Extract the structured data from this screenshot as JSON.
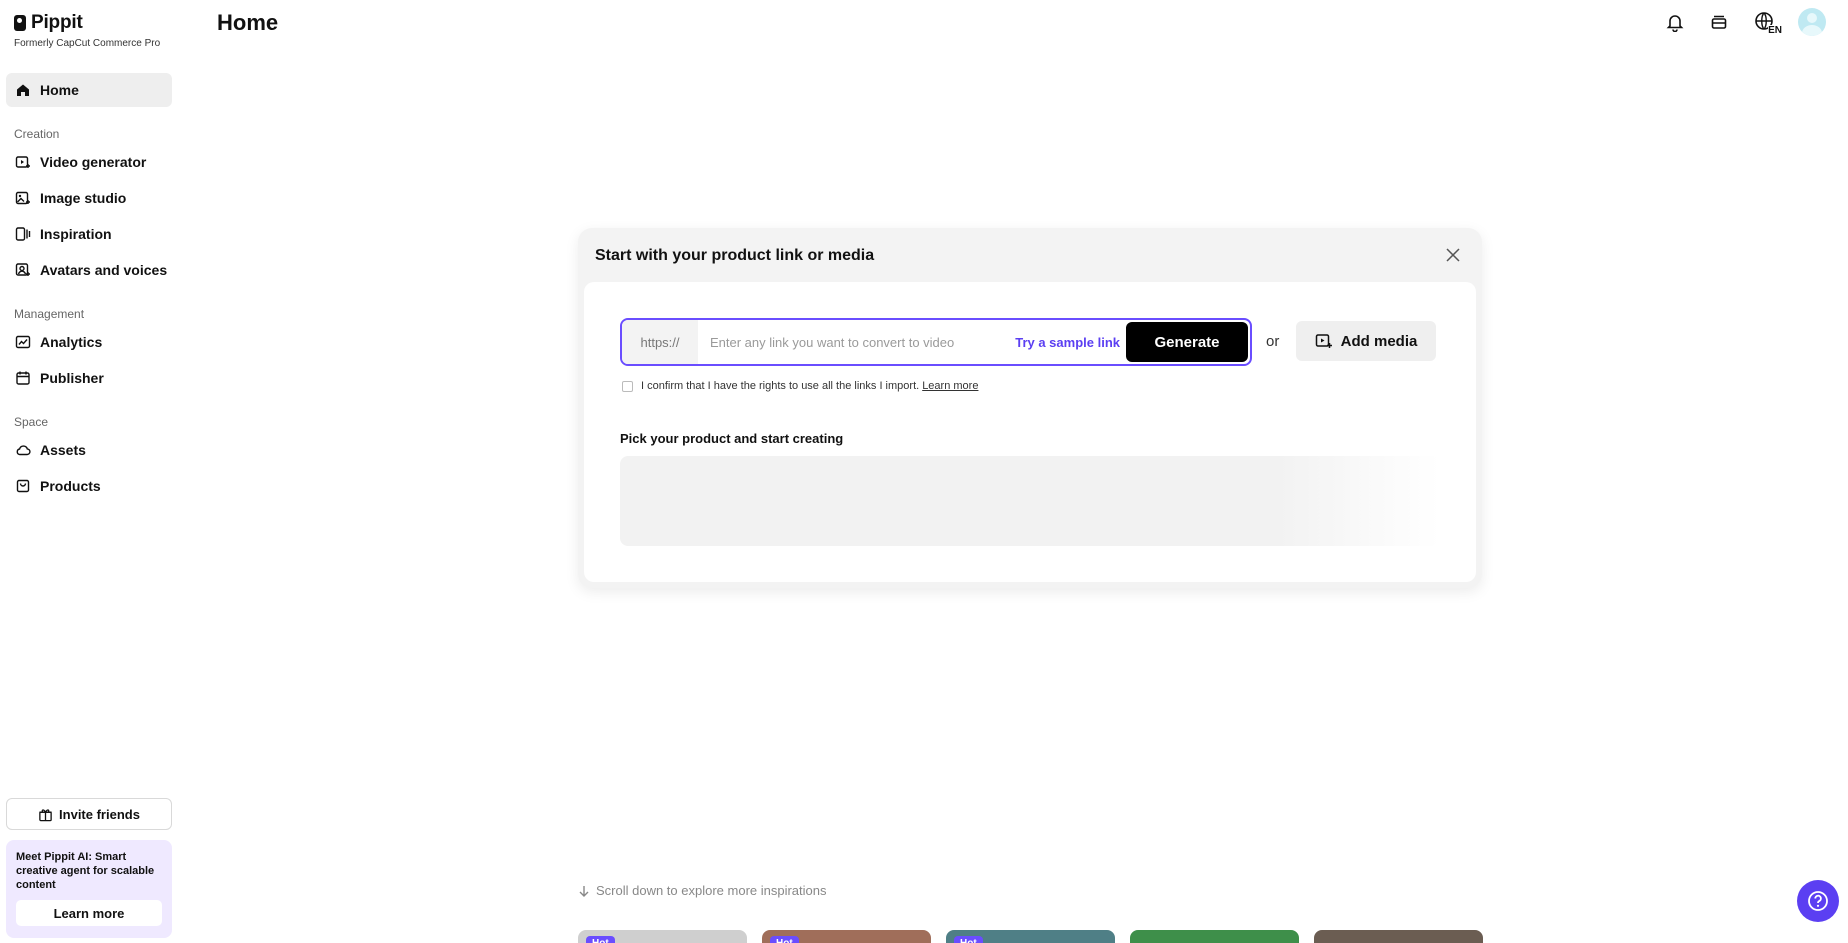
{
  "brand": {
    "name": "Pippit",
    "subtitle": "Formerly CapCut Commerce Pro"
  },
  "header": {
    "title": "Home",
    "language_badge": "EN"
  },
  "sidebar": {
    "items": [
      {
        "label": "Home",
        "icon": "home-icon"
      },
      {
        "label": "Video generator",
        "icon": "video-generator-icon"
      },
      {
        "label": "Image studio",
        "icon": "image-studio-icon"
      },
      {
        "label": "Inspiration",
        "icon": "inspiration-icon"
      },
      {
        "label": "Avatars and voices",
        "icon": "avatar-voice-icon"
      },
      {
        "label": "Analytics",
        "icon": "analytics-icon"
      },
      {
        "label": "Publisher",
        "icon": "calendar-icon"
      },
      {
        "label": "Assets",
        "icon": "cloud-icon"
      },
      {
        "label": "Products",
        "icon": "bag-icon"
      }
    ],
    "sections": [
      "Creation",
      "Management",
      "Space"
    ],
    "invite_label": "Invite friends",
    "promo": {
      "text": "Meet Pippit AI: Smart creative agent for scalable content",
      "button": "Learn more"
    }
  },
  "card": {
    "title": "Start with your product link or media",
    "prefix": "https://",
    "placeholder": "Enter any link you want to convert to video",
    "sample_link": "Try a sample link",
    "generate_label": "Generate",
    "or": "or",
    "add_media_label": "Add media",
    "confirm_text": "I confirm that I have the rights to use all the links I import.",
    "learn_more": "Learn more",
    "pick_title": "Pick your product and start creating"
  },
  "bottom": {
    "scroll_hint": "Scroll down to explore more inspirations",
    "thumbs": [
      {
        "badge": "Hot",
        "color": "#cfcfcf"
      },
      {
        "badge": "Hot",
        "color": "#a06e5a"
      },
      {
        "badge": "Hot",
        "color": "#4f7f86"
      },
      {
        "badge": "",
        "color": "#3e8f4a"
      },
      {
        "badge": "",
        "color": "#6b5d52"
      }
    ]
  },
  "colors": {
    "accent": "#5b3ff2",
    "promo_bg": "#efe9ff"
  }
}
